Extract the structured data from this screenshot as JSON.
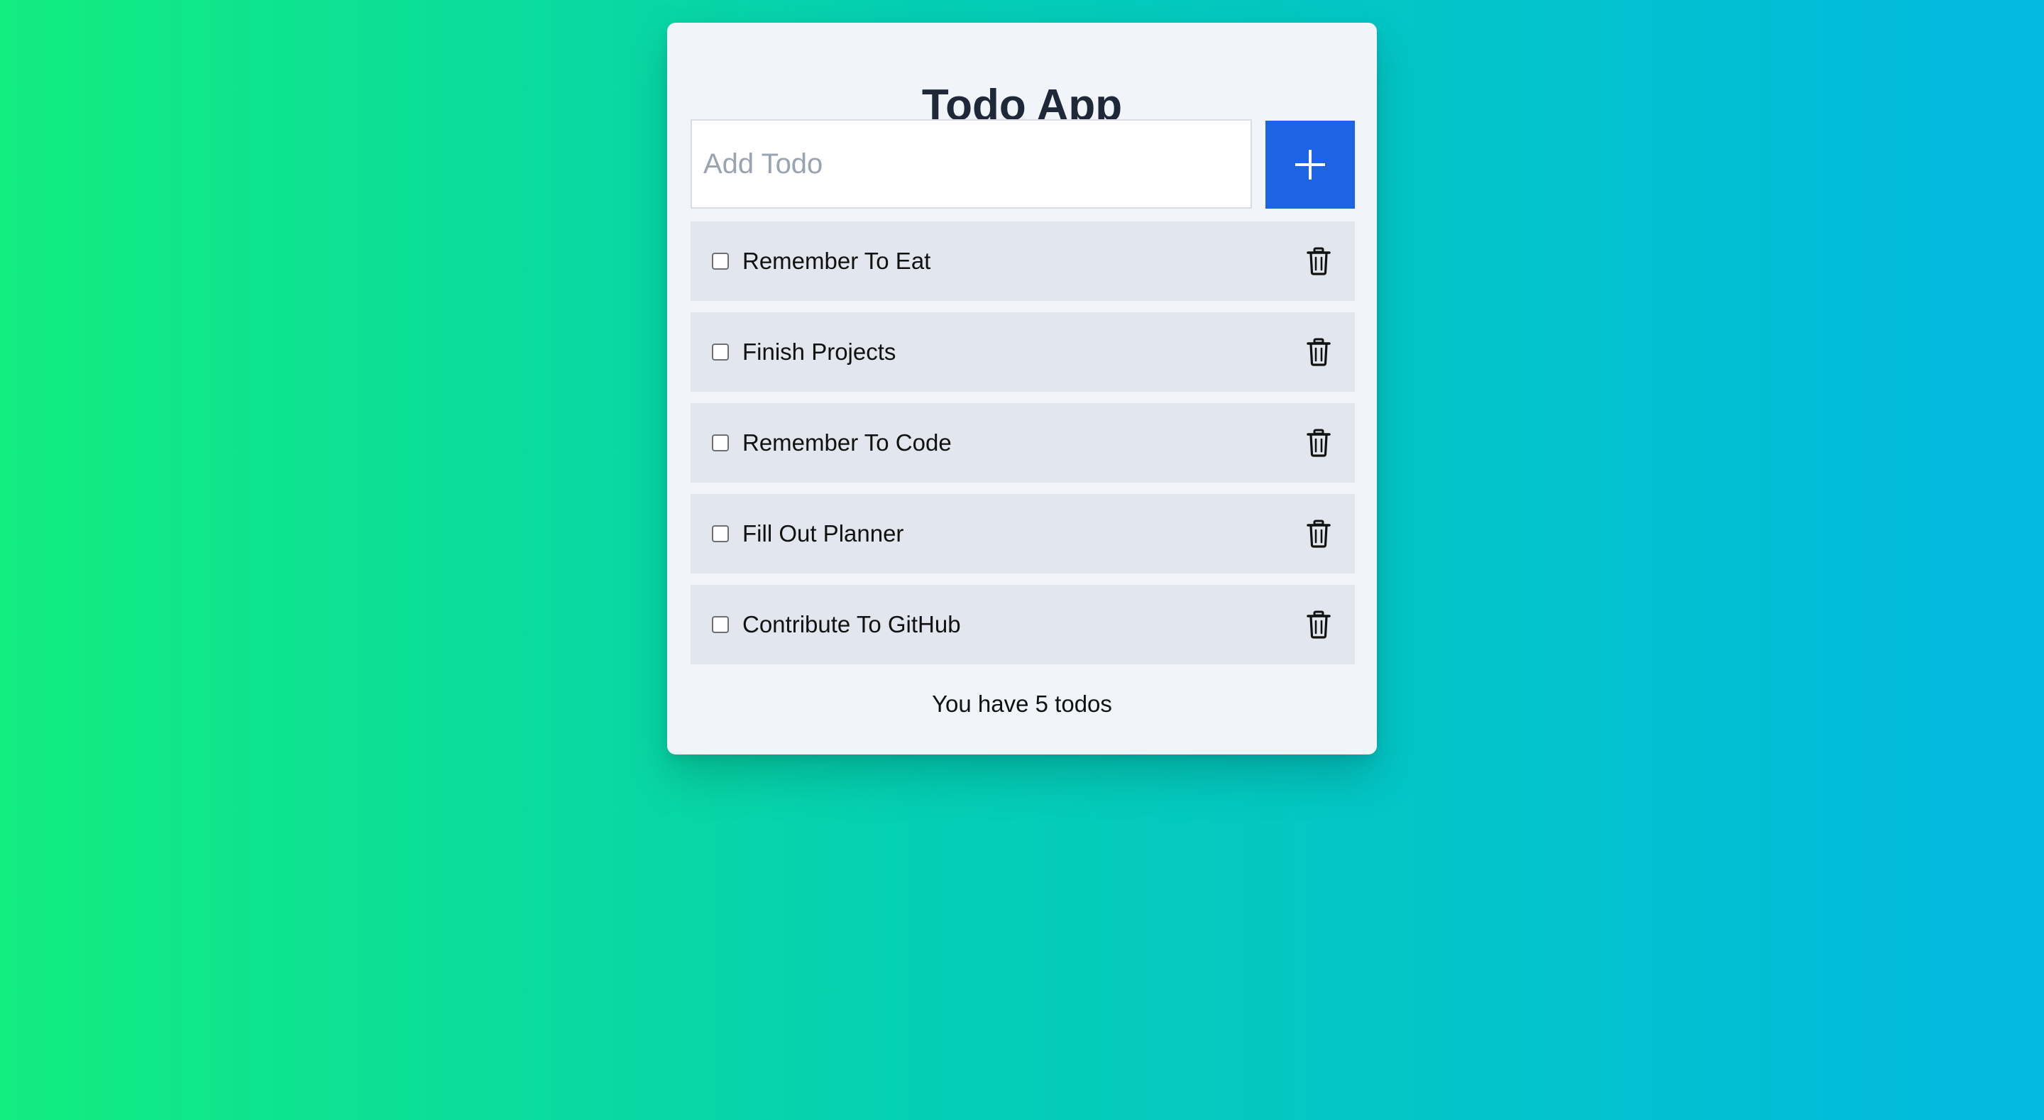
{
  "app": {
    "title": "Todo App"
  },
  "input": {
    "placeholder": "Add Todo",
    "value": ""
  },
  "add_button": {
    "icon": "plus-icon"
  },
  "todos": [
    {
      "label": "Remember To Eat",
      "checked": false,
      "delete_icon": "trash-icon"
    },
    {
      "label": "Finish Projects",
      "checked": false,
      "delete_icon": "trash-icon"
    },
    {
      "label": "Remember To Code",
      "checked": false,
      "delete_icon": "trash-icon"
    },
    {
      "label": "Fill Out Planner",
      "checked": false,
      "delete_icon": "trash-icon"
    },
    {
      "label": "Contribute To GitHub",
      "checked": false,
      "delete_icon": "trash-icon"
    }
  ],
  "footer": {
    "summary": "You have 5 todos"
  },
  "colors": {
    "accent": "#1d63e6",
    "card_background": "#f1f4f9",
    "item_background": "#e2e7ef",
    "title_text": "#1e2838",
    "gradient_start": "#13ec7f",
    "gradient_end": "#02b9e0"
  }
}
